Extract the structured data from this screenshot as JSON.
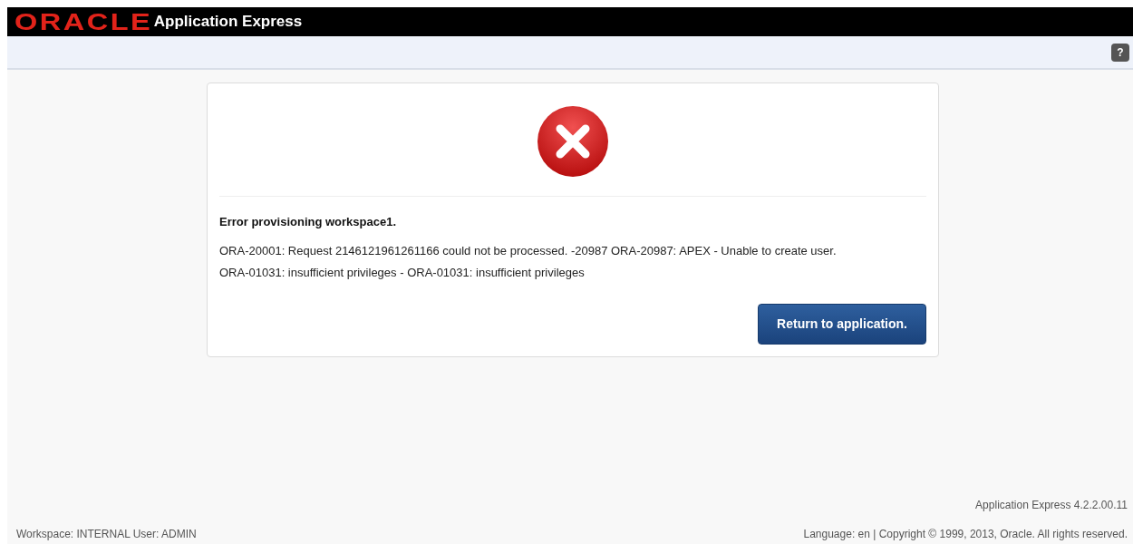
{
  "header": {
    "logo": "ORACLE",
    "title": "Application Express"
  },
  "toolbar": {
    "help": "?"
  },
  "error": {
    "heading": "Error provisioning workspace1.",
    "lines": [
      "ORA-20001: Request 2146121961261166 could not be processed. -20987 ORA-20987: APEX - Unable to create user.",
      "ORA-01031: insufficient privileges - ORA-01031: insufficient privileges"
    ],
    "button": "Return to application."
  },
  "footer": {
    "version": "Application Express 4.2.2.00.11",
    "user": "Workspace: INTERNAL User: ADMIN",
    "copyright": "Language: en | Copyright © 1999, 2013, Oracle. All rights reserved."
  }
}
